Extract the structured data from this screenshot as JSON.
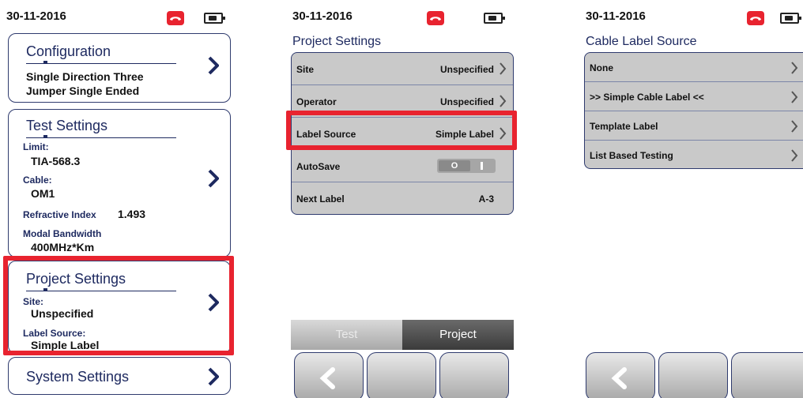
{
  "screen1": {
    "date": "30-11-2016",
    "configuration": {
      "title": "Configuration",
      "line1": "Single Direction Three",
      "line2": "Jumper Single Ended"
    },
    "test_settings": {
      "title": "Test Settings",
      "limit_label": "Limit:",
      "limit_value": "TIA-568.3",
      "cable_label": "Cable:",
      "cable_value": "OM1",
      "refractive_label": "Refractive Index",
      "refractive_value": "1.493",
      "modal_label": "Modal Bandwidth",
      "modal_value": "400MHz*Km"
    },
    "project_settings": {
      "title": "Project Settings",
      "site_label": "Site:",
      "site_value": "Unspecified",
      "label_source_label": "Label Source:",
      "label_source_value": "Simple Label"
    },
    "system_settings": {
      "title": "System Settings"
    }
  },
  "screen2": {
    "date": "30-11-2016",
    "title": "Project Settings",
    "rows": [
      {
        "label": "Site",
        "value": "Unspecified"
      },
      {
        "label": "Operator",
        "value": "Unspecified"
      },
      {
        "label": "Label Source",
        "value": "Simple Label"
      },
      {
        "label": "AutoSave",
        "toggle_text": "O"
      },
      {
        "label": "Next Label",
        "value": "A-3"
      }
    ],
    "tabs": {
      "test": "Test",
      "project": "Project"
    }
  },
  "screen3": {
    "date": "30-11-2016",
    "title": "Cable Label Source",
    "rows": [
      {
        "label": "None"
      },
      {
        "label": ">> Simple Cable Label <<"
      },
      {
        "label": "Template Label"
      },
      {
        "label": "List Based Testing"
      }
    ]
  },
  "colors": {
    "accent_navy": "#1e2a60",
    "highlight_red": "#e8232f",
    "list_gray": "#c9c9c9"
  },
  "icons": [
    "phone-icon",
    "battery-icon",
    "chevron-right-icon",
    "back-arrow-icon"
  ]
}
